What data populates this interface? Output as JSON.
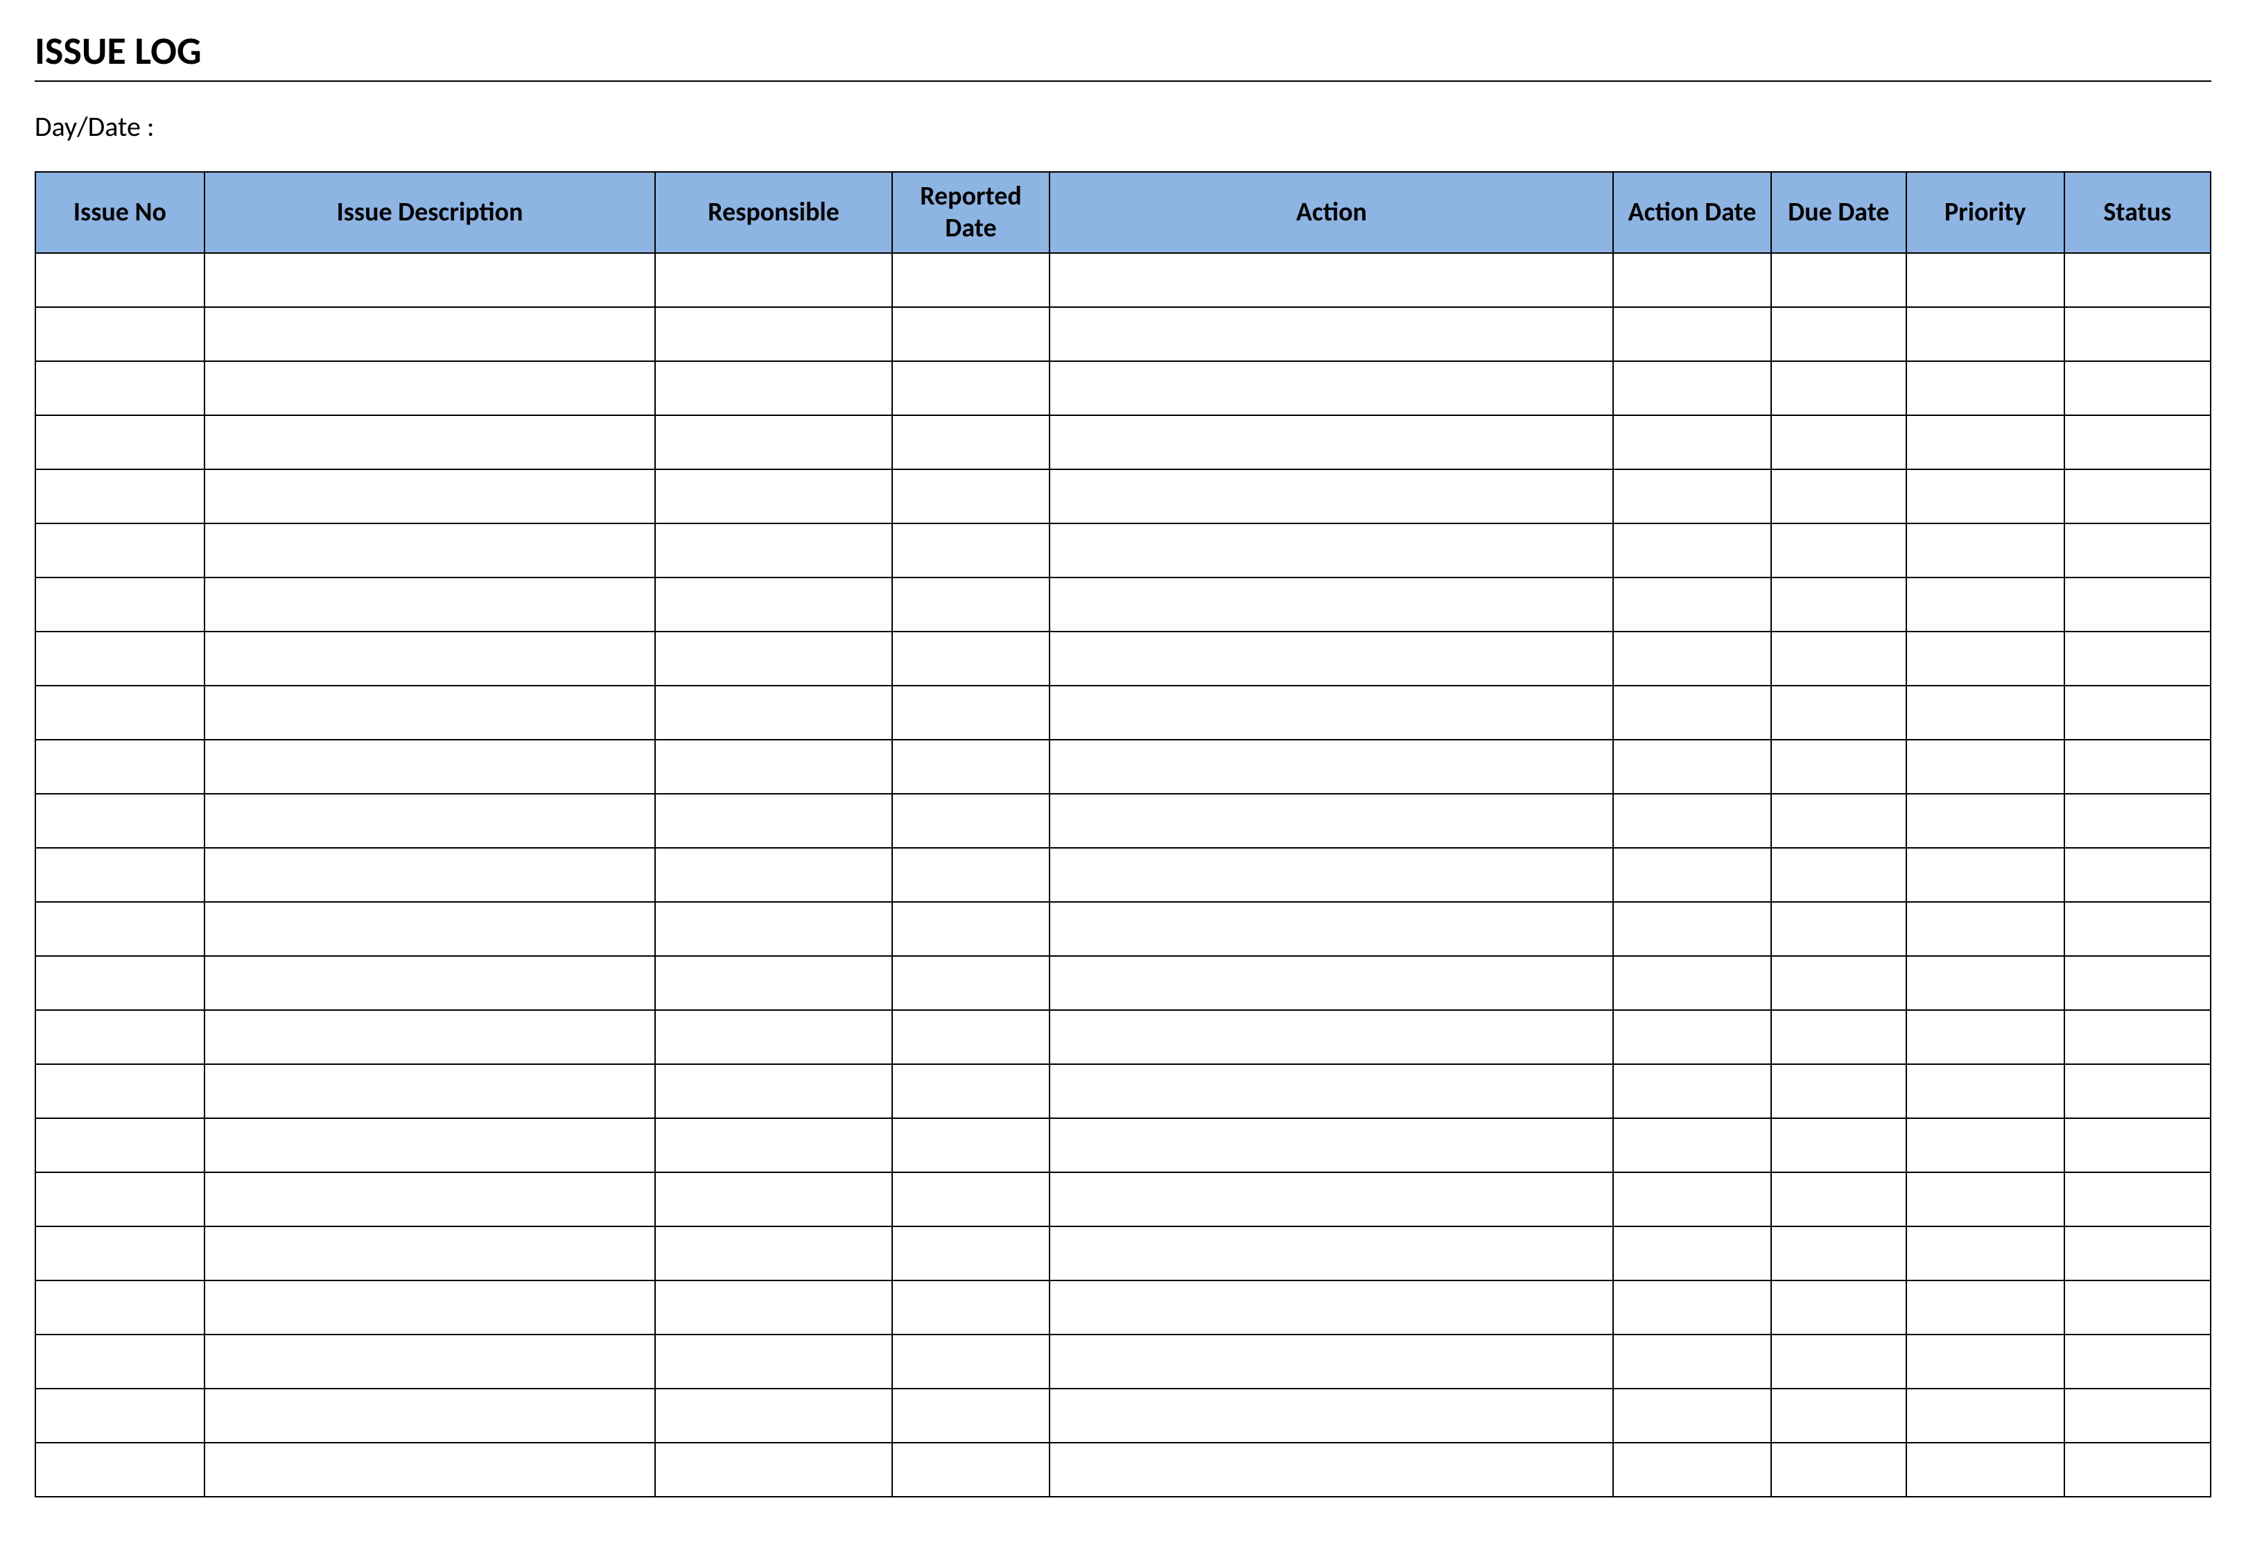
{
  "title": "ISSUE LOG",
  "day_date_label": "Day/Date :",
  "table": {
    "headers": {
      "issue_no": "Issue No",
      "issue_description": "Issue Description",
      "responsible": "Responsible",
      "reported_date": "Reported Date",
      "action": "Action",
      "action_date": "Action Date",
      "due_date": "Due Date",
      "priority": "Priority",
      "status": "Status"
    },
    "row_count": 23,
    "rows": [
      {
        "issue_no": "",
        "issue_description": "",
        "responsible": "",
        "reported_date": "",
        "action": "",
        "action_date": "",
        "due_date": "",
        "priority": "",
        "status": ""
      },
      {
        "issue_no": "",
        "issue_description": "",
        "responsible": "",
        "reported_date": "",
        "action": "",
        "action_date": "",
        "due_date": "",
        "priority": "",
        "status": ""
      },
      {
        "issue_no": "",
        "issue_description": "",
        "responsible": "",
        "reported_date": "",
        "action": "",
        "action_date": "",
        "due_date": "",
        "priority": "",
        "status": ""
      },
      {
        "issue_no": "",
        "issue_description": "",
        "responsible": "",
        "reported_date": "",
        "action": "",
        "action_date": "",
        "due_date": "",
        "priority": "",
        "status": ""
      },
      {
        "issue_no": "",
        "issue_description": "",
        "responsible": "",
        "reported_date": "",
        "action": "",
        "action_date": "",
        "due_date": "",
        "priority": "",
        "status": ""
      },
      {
        "issue_no": "",
        "issue_description": "",
        "responsible": "",
        "reported_date": "",
        "action": "",
        "action_date": "",
        "due_date": "",
        "priority": "",
        "status": ""
      },
      {
        "issue_no": "",
        "issue_description": "",
        "responsible": "",
        "reported_date": "",
        "action": "",
        "action_date": "",
        "due_date": "",
        "priority": "",
        "status": ""
      },
      {
        "issue_no": "",
        "issue_description": "",
        "responsible": "",
        "reported_date": "",
        "action": "",
        "action_date": "",
        "due_date": "",
        "priority": "",
        "status": ""
      },
      {
        "issue_no": "",
        "issue_description": "",
        "responsible": "",
        "reported_date": "",
        "action": "",
        "action_date": "",
        "due_date": "",
        "priority": "",
        "status": ""
      },
      {
        "issue_no": "",
        "issue_description": "",
        "responsible": "",
        "reported_date": "",
        "action": "",
        "action_date": "",
        "due_date": "",
        "priority": "",
        "status": ""
      },
      {
        "issue_no": "",
        "issue_description": "",
        "responsible": "",
        "reported_date": "",
        "action": "",
        "action_date": "",
        "due_date": "",
        "priority": "",
        "status": ""
      },
      {
        "issue_no": "",
        "issue_description": "",
        "responsible": "",
        "reported_date": "",
        "action": "",
        "action_date": "",
        "due_date": "",
        "priority": "",
        "status": ""
      },
      {
        "issue_no": "",
        "issue_description": "",
        "responsible": "",
        "reported_date": "",
        "action": "",
        "action_date": "",
        "due_date": "",
        "priority": "",
        "status": ""
      },
      {
        "issue_no": "",
        "issue_description": "",
        "responsible": "",
        "reported_date": "",
        "action": "",
        "action_date": "",
        "due_date": "",
        "priority": "",
        "status": ""
      },
      {
        "issue_no": "",
        "issue_description": "",
        "responsible": "",
        "reported_date": "",
        "action": "",
        "action_date": "",
        "due_date": "",
        "priority": "",
        "status": ""
      },
      {
        "issue_no": "",
        "issue_description": "",
        "responsible": "",
        "reported_date": "",
        "action": "",
        "action_date": "",
        "due_date": "",
        "priority": "",
        "status": ""
      },
      {
        "issue_no": "",
        "issue_description": "",
        "responsible": "",
        "reported_date": "",
        "action": "",
        "action_date": "",
        "due_date": "",
        "priority": "",
        "status": ""
      },
      {
        "issue_no": "",
        "issue_description": "",
        "responsible": "",
        "reported_date": "",
        "action": "",
        "action_date": "",
        "due_date": "",
        "priority": "",
        "status": ""
      },
      {
        "issue_no": "",
        "issue_description": "",
        "responsible": "",
        "reported_date": "",
        "action": "",
        "action_date": "",
        "due_date": "",
        "priority": "",
        "status": ""
      },
      {
        "issue_no": "",
        "issue_description": "",
        "responsible": "",
        "reported_date": "",
        "action": "",
        "action_date": "",
        "due_date": "",
        "priority": "",
        "status": ""
      },
      {
        "issue_no": "",
        "issue_description": "",
        "responsible": "",
        "reported_date": "",
        "action": "",
        "action_date": "",
        "due_date": "",
        "priority": "",
        "status": ""
      },
      {
        "issue_no": "",
        "issue_description": "",
        "responsible": "",
        "reported_date": "",
        "action": "",
        "action_date": "",
        "due_date": "",
        "priority": "",
        "status": ""
      },
      {
        "issue_no": "",
        "issue_description": "",
        "responsible": "",
        "reported_date": "",
        "action": "",
        "action_date": "",
        "due_date": "",
        "priority": "",
        "status": ""
      }
    ]
  },
  "colors": {
    "header_bg": "#8db4e2",
    "border": "#000000"
  }
}
